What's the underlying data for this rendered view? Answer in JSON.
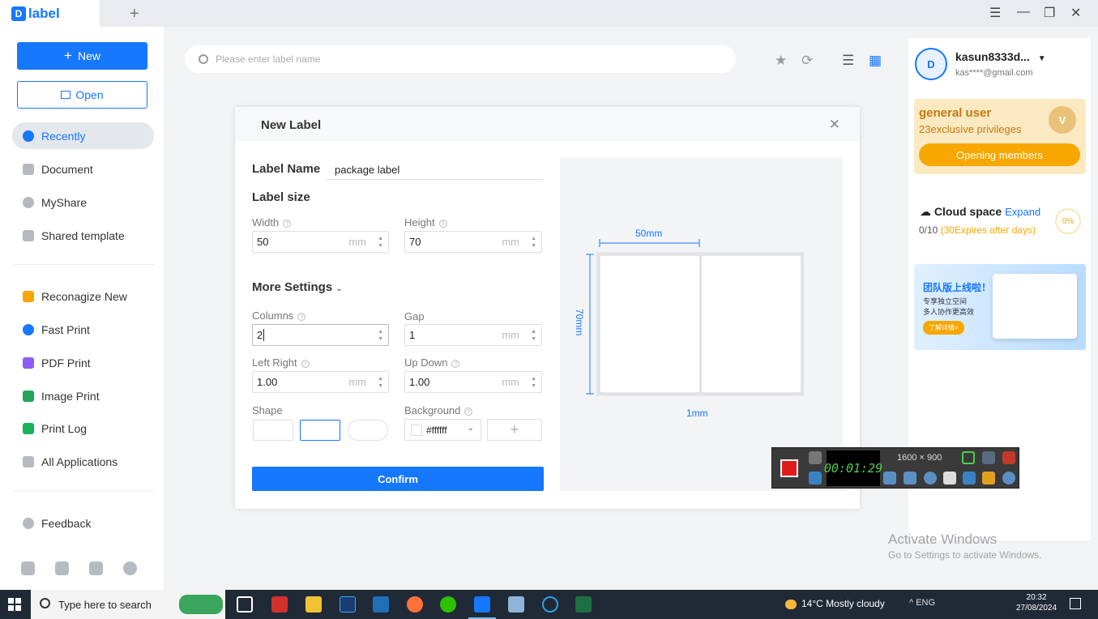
{
  "app": {
    "name": "label",
    "add_tab": "+"
  },
  "window_controls": {
    "menu": "☰",
    "minimize": "—",
    "restore": "❐",
    "close": "✕"
  },
  "sidebar": {
    "new_label": "New",
    "open_label": "Open",
    "items": [
      {
        "label": "Recently",
        "active": true
      },
      {
        "label": "Document"
      },
      {
        "label": "MyShare"
      },
      {
        "label": "Shared template"
      },
      {
        "label": "Reconagize New"
      },
      {
        "label": "Fast Print"
      },
      {
        "label": "PDF Print"
      },
      {
        "label": "Image Print"
      },
      {
        "label": "Print Log"
      },
      {
        "label": "All Applications"
      },
      {
        "label": "Feedback"
      }
    ]
  },
  "search": {
    "placeholder": "Please enter label name"
  },
  "user": {
    "avatar_letter": "D",
    "name": "kasun8333d...",
    "email": "kas****@gmail.com",
    "dropdown": "▼"
  },
  "membership": {
    "title": "general user",
    "privileges": "23exclusive privileges",
    "button": "Opening members",
    "badge": "V"
  },
  "cloud": {
    "title": "Cloud space",
    "expand": "Expand",
    "usage": "0/10",
    "expires": "(30Expires after days)",
    "percent": "0%"
  },
  "banner": {
    "title": "团队版上线啦！",
    "line1": "专享独立空间",
    "line2": "多人协作更高效",
    "button": "了解详情>"
  },
  "dialog": {
    "title": "New Label",
    "close": "✕",
    "label_name_caption": "Label Name",
    "label_name_value": "package label",
    "label_size_caption": "Label size",
    "width_caption": "Width",
    "width_value": "50",
    "height_caption": "Height",
    "height_value": "70",
    "unit": "mm",
    "more_settings": "More Settings",
    "columns_caption": "Columns",
    "columns_value": "2",
    "gap_caption": "Gap",
    "gap_value": "1",
    "left_right_caption": "Left Right",
    "left_right_value": "1.00",
    "up_down_caption": "Up Down",
    "up_down_value": "1.00",
    "shape_caption": "Shape",
    "background_caption": "Background",
    "background_value": "#ffffff",
    "confirm": "Confirm",
    "preview": {
      "width_label": "50mm",
      "height_label": "70mm",
      "gap_label": "1mm"
    }
  },
  "recorder": {
    "resolution": "1600 × 900",
    "timer": "00:01:29"
  },
  "activate": {
    "line1": "Activate Windows",
    "line2": "Go to Settings to activate Windows."
  },
  "taskbar": {
    "search_placeholder": "Type here to search",
    "weather": "14°C  Mostly cloudy",
    "tray": "^  ENG",
    "time": "20:32",
    "date": "27/08/2024"
  },
  "colors": {
    "accent": "#1677ff",
    "gold": "#f7a700",
    "recorder_red": "#e01b1b"
  }
}
